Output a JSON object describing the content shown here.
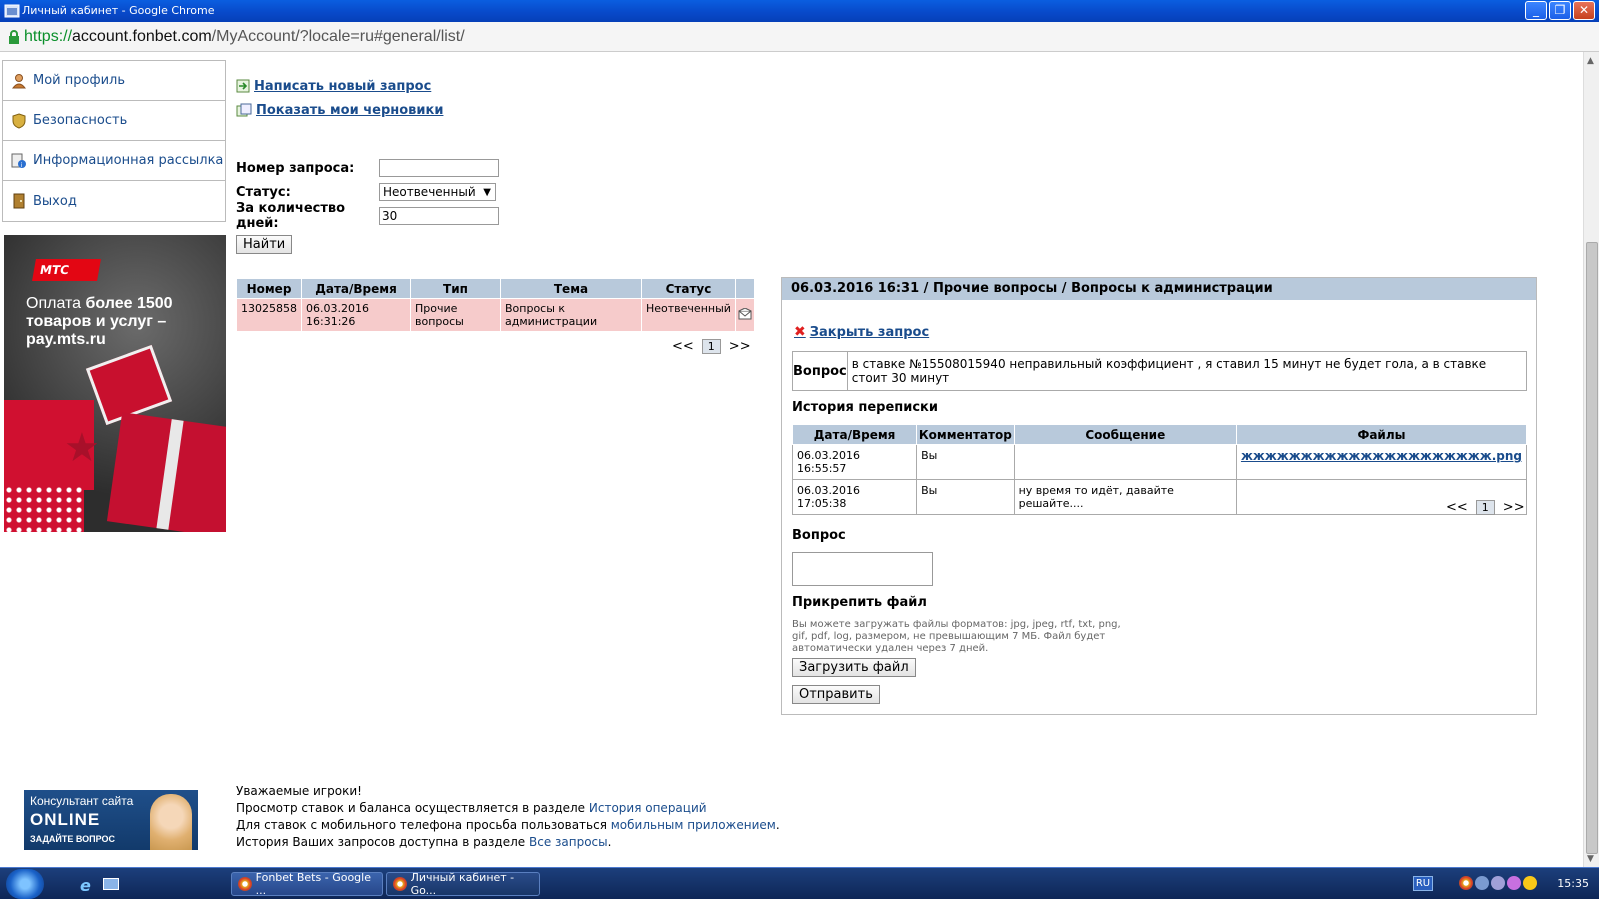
{
  "window": {
    "title": "Личный кабинет - Google Chrome"
  },
  "address": {
    "scheme": "https://",
    "host": "account.fonbet.com",
    "path": "/MyAccount/?locale=ru#general/list/"
  },
  "menu": {
    "items": [
      {
        "label": "Мой профиль",
        "icon": "user-icon"
      },
      {
        "label": "Безопасность",
        "icon": "shield-icon"
      },
      {
        "label": "Информационная рассылка",
        "icon": "newsletter-icon"
      },
      {
        "label": "Выход",
        "icon": "exit-icon"
      }
    ]
  },
  "ad": {
    "brand": "МТС",
    "line1_pre": "Оплата ",
    "line1_bold": "более 1500",
    "line2": "товаров и услуг –",
    "line3": "pay.mts.ru"
  },
  "links": {
    "new_request": "Написать новый запрос",
    "drafts": "Показать мои черновики"
  },
  "filter": {
    "number_label": "Номер запроса:",
    "number_value": "",
    "status_label": "Статус:",
    "status_value": "Неотвеченный",
    "days_label": "За количество дней:",
    "days_value": "30",
    "find_button": "Найти"
  },
  "requests": {
    "headers": [
      "Номер",
      "Дата/Время",
      "Тип",
      "Тема",
      "Статус"
    ],
    "rows": [
      {
        "number": "13025858",
        "datetime_line1": "06.03.2016",
        "datetime_line2": "16:31:26",
        "type_line1": "Прочие",
        "type_line2": "вопросы",
        "topic_line1": "Вопросы к",
        "topic_line2": "администрации",
        "status": "Неотвеченный"
      }
    ],
    "pager": {
      "prev": "<<",
      "current": "1",
      "next": ">>"
    }
  },
  "detail": {
    "header": "06.03.2016 16:31 / Прочие вопросы / Вопросы к администрации",
    "close_link": "Закрыть запрос",
    "question_label": "Вопрос",
    "question_text": "в ставке №15508015940 неправильный коэффициент , я ставил 15 минут не будет гола, а в ставке стоит 30 минут",
    "history_title": "История переписки",
    "history_headers": [
      "Дата/Время",
      "Комментатор",
      "Сообщение",
      "Файлы"
    ],
    "history_rows": [
      {
        "datetime": "06.03.2016 16:55:57",
        "author": "Вы",
        "message": "",
        "file": "жжжжжжжжжжжжжжжжжжжжж.png"
      },
      {
        "datetime": "06.03.2016 17:05:38",
        "author": "Вы",
        "message": "ну время то идёт, давайте решайте....",
        "file": ""
      }
    ],
    "pager": {
      "prev": "<<",
      "current": "1",
      "next": ">>"
    },
    "reply_label": "Вопрос",
    "attach_title": "Прикрепить файл",
    "attach_hint": "Вы можете загружать файлы форматов: jpg, jpeg, rtf, txt, png, gif, pdf, log, размером, не превышающим 7 МБ. Файл будет автоматически удален через 7 дней.",
    "upload_button": "Загрузить файл",
    "send_button": "Отправить"
  },
  "consultant": {
    "line1": "Консультант сайта",
    "line2": "ONLINE",
    "line3": "ЗАДАЙТЕ ВОПРОС"
  },
  "footer": {
    "line1": "Уважаемые игроки!",
    "line2_pre": "Просмотр ставок и баланса осуществляется в разделе ",
    "line2_link": "История операций",
    "line3_pre": "Для ставок с мобильного телефона просьба пользоваться ",
    "line3_link": "мобильным приложением",
    "line3_post": ".",
    "line4_pre": "История Ваших запросов доступна в разделе ",
    "line4_link": "Все запросы",
    "line4_post": "."
  },
  "taskbar": {
    "tasks": [
      {
        "label": "Fonbet Bets - Google ..."
      },
      {
        "label": "Личный кабинет - Go..."
      }
    ],
    "lang": "RU",
    "clock": "15:35"
  }
}
